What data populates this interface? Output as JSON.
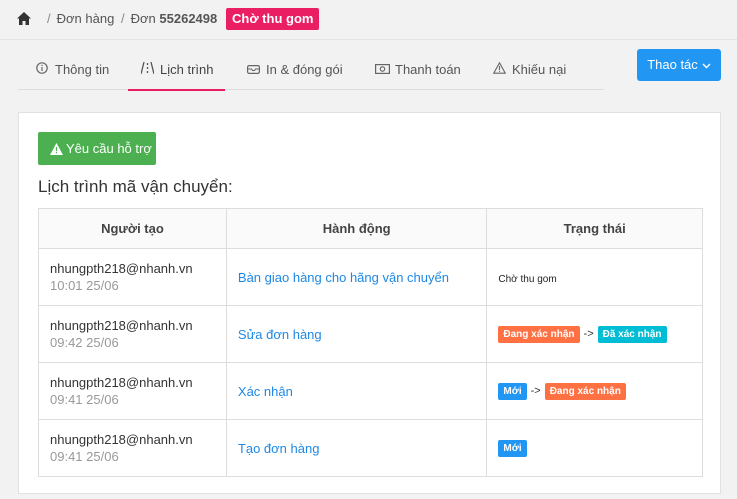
{
  "breadcrumb": {
    "home_icon": "home-icon",
    "orders": "Đơn hàng",
    "order_prefix": "Đơn",
    "order_number": "55262498",
    "status": "Chờ thu gom",
    "status_color": "#e91e63"
  },
  "tabs": [
    {
      "label": "Thông tin",
      "icon": "info-icon"
    },
    {
      "label": "Lịch trình",
      "icon": "road-icon",
      "active": true
    },
    {
      "label": "In & đóng gói",
      "icon": "package-icon"
    },
    {
      "label": "Thanh toán",
      "icon": "money-icon"
    },
    {
      "label": "Khiếu nại",
      "icon": "warning-icon"
    }
  ],
  "actions_button": "Thao tác",
  "support_button": "Yêu cầu hỗ trợ",
  "section_title": "Lịch trình mã vận chuyển:",
  "table": {
    "headers": [
      "Người tạo",
      "Hành động",
      "Trạng thái"
    ],
    "rows": [
      {
        "creator": "nhungpth218@nhanh.vn",
        "time": "10:01 25/06",
        "action": "Bàn giao hàng cho hãng vận chuyển",
        "status_text": "Chờ thu gom"
      },
      {
        "creator": "nhungpth218@nhanh.vn",
        "time": "09:42 25/06",
        "action": "Sửa đơn hàng",
        "from": "Đang xác nhận",
        "arrow": "->",
        "to": "Đã xác nhận"
      },
      {
        "creator": "nhungpth218@nhanh.vn",
        "time": "09:41 25/06",
        "action": "Xác nhận",
        "from": "Mới",
        "arrow": "->",
        "to": "Đang xác nhận"
      },
      {
        "creator": "nhungpth218@nhanh.vn",
        "time": "09:41 25/06",
        "action": "Tạo đơn hàng",
        "to": "Mới"
      }
    ]
  },
  "colors": {
    "accent": "#e91e63",
    "primary": "#2196f3",
    "success": "#4caf50",
    "status_new": "#2196f3",
    "status_confirming": "#ff7043",
    "status_confirmed": "#00bcd4"
  }
}
